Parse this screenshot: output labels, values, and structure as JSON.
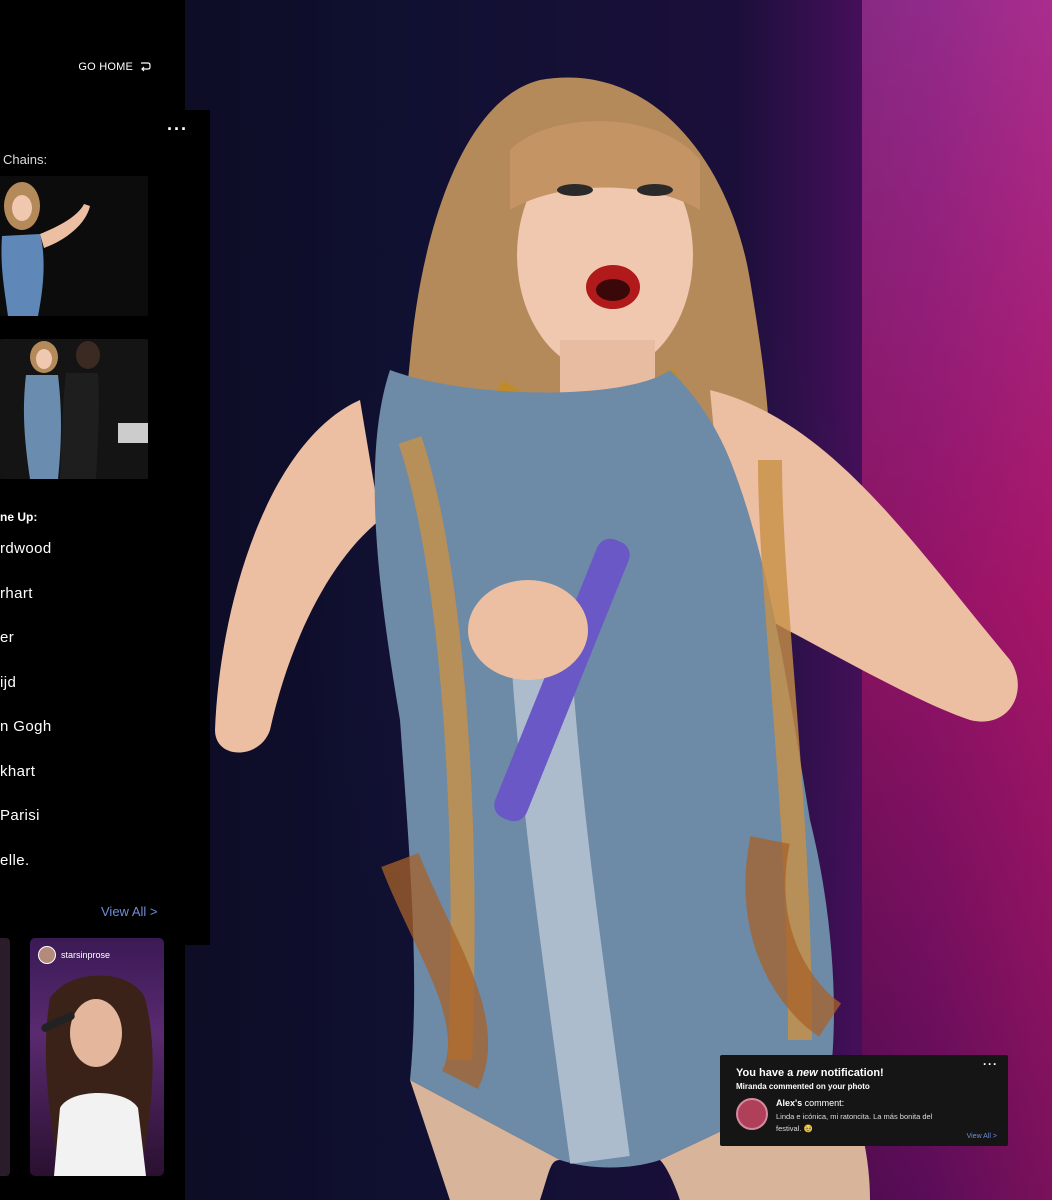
{
  "topbar": {
    "go_home_label": "GO HOME"
  },
  "panel": {
    "chains_label": "Chains:",
    "lineup_label": "ne Up:",
    "lineup_items": [
      "rdwood",
      "rhart",
      "er",
      "ijd",
      "n Gogh",
      "khart",
      "Parisi",
      "elle."
    ],
    "view_all_label": "View All >"
  },
  "story": {
    "username": "starsinprose"
  },
  "notification": {
    "title_prefix": "You have a ",
    "title_emphasis": "new",
    "title_suffix": " notification!",
    "subtitle": "Miranda commented on your photo",
    "commenter": "Alex's",
    "comment_label": " comment:",
    "comment_text": "Linda e icónica, mi ratoncita. La más bonita del festival. 🥹",
    "view_all_label": "View All >"
  },
  "colors": {
    "link": "#6e8fd8",
    "panel_bg": "#000000",
    "notif_bg": "#151515"
  }
}
